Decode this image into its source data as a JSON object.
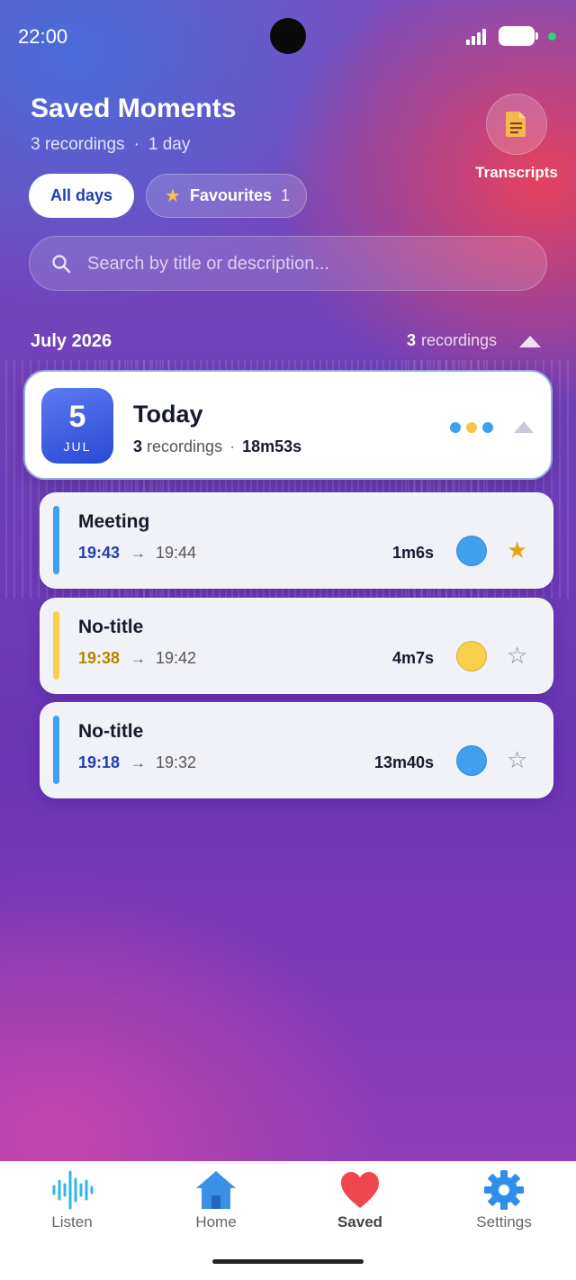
{
  "status_bar": {
    "time": "22:00"
  },
  "header": {
    "title": "Saved Moments",
    "recordings_count": "3 recordings",
    "separator": "·",
    "days_count": "1 day",
    "transcripts_label": "Transcripts"
  },
  "filters": {
    "all_days_label": "All days",
    "favourites_label": "Favourites",
    "favourites_count": "1"
  },
  "search": {
    "placeholder": "Search by title or description..."
  },
  "month_group": {
    "label": "July 2026",
    "count": "3",
    "count_suffix": "recordings"
  },
  "day_group": {
    "day_number": "5",
    "month_abbr": "JUL",
    "title": "Today",
    "count": "3",
    "count_suffix": "recordings",
    "separator": "·",
    "total_duration": "18m53s",
    "dot_colors": [
      "#3fa0f0",
      "#f5c543",
      "#3fa0f0"
    ]
  },
  "recordings": [
    {
      "title": "Meeting",
      "start": "19:43",
      "arrow": "→",
      "end": "19:44",
      "duration": "1m6s",
      "color": "#3fa0f0",
      "start_color": "#1f3fb0",
      "favourite": true
    },
    {
      "title": "No-title",
      "start": "19:38",
      "arrow": "→",
      "end": "19:42",
      "duration": "4m7s",
      "color": "#f8d04a",
      "start_color": "#b38600",
      "favourite": false
    },
    {
      "title": "No-title",
      "start": "19:18",
      "arrow": "→",
      "end": "19:32",
      "duration": "13m40s",
      "color": "#3fa0f0",
      "start_color": "#1f3fb0",
      "favourite": false
    }
  ],
  "bottom_nav": {
    "items": [
      {
        "label": "Listen",
        "icon": "waveform-icon"
      },
      {
        "label": "Home",
        "icon": "home-icon"
      },
      {
        "label": "Saved",
        "icon": "heart-icon",
        "active": true
      },
      {
        "label": "Settings",
        "icon": "gear-icon"
      }
    ]
  }
}
